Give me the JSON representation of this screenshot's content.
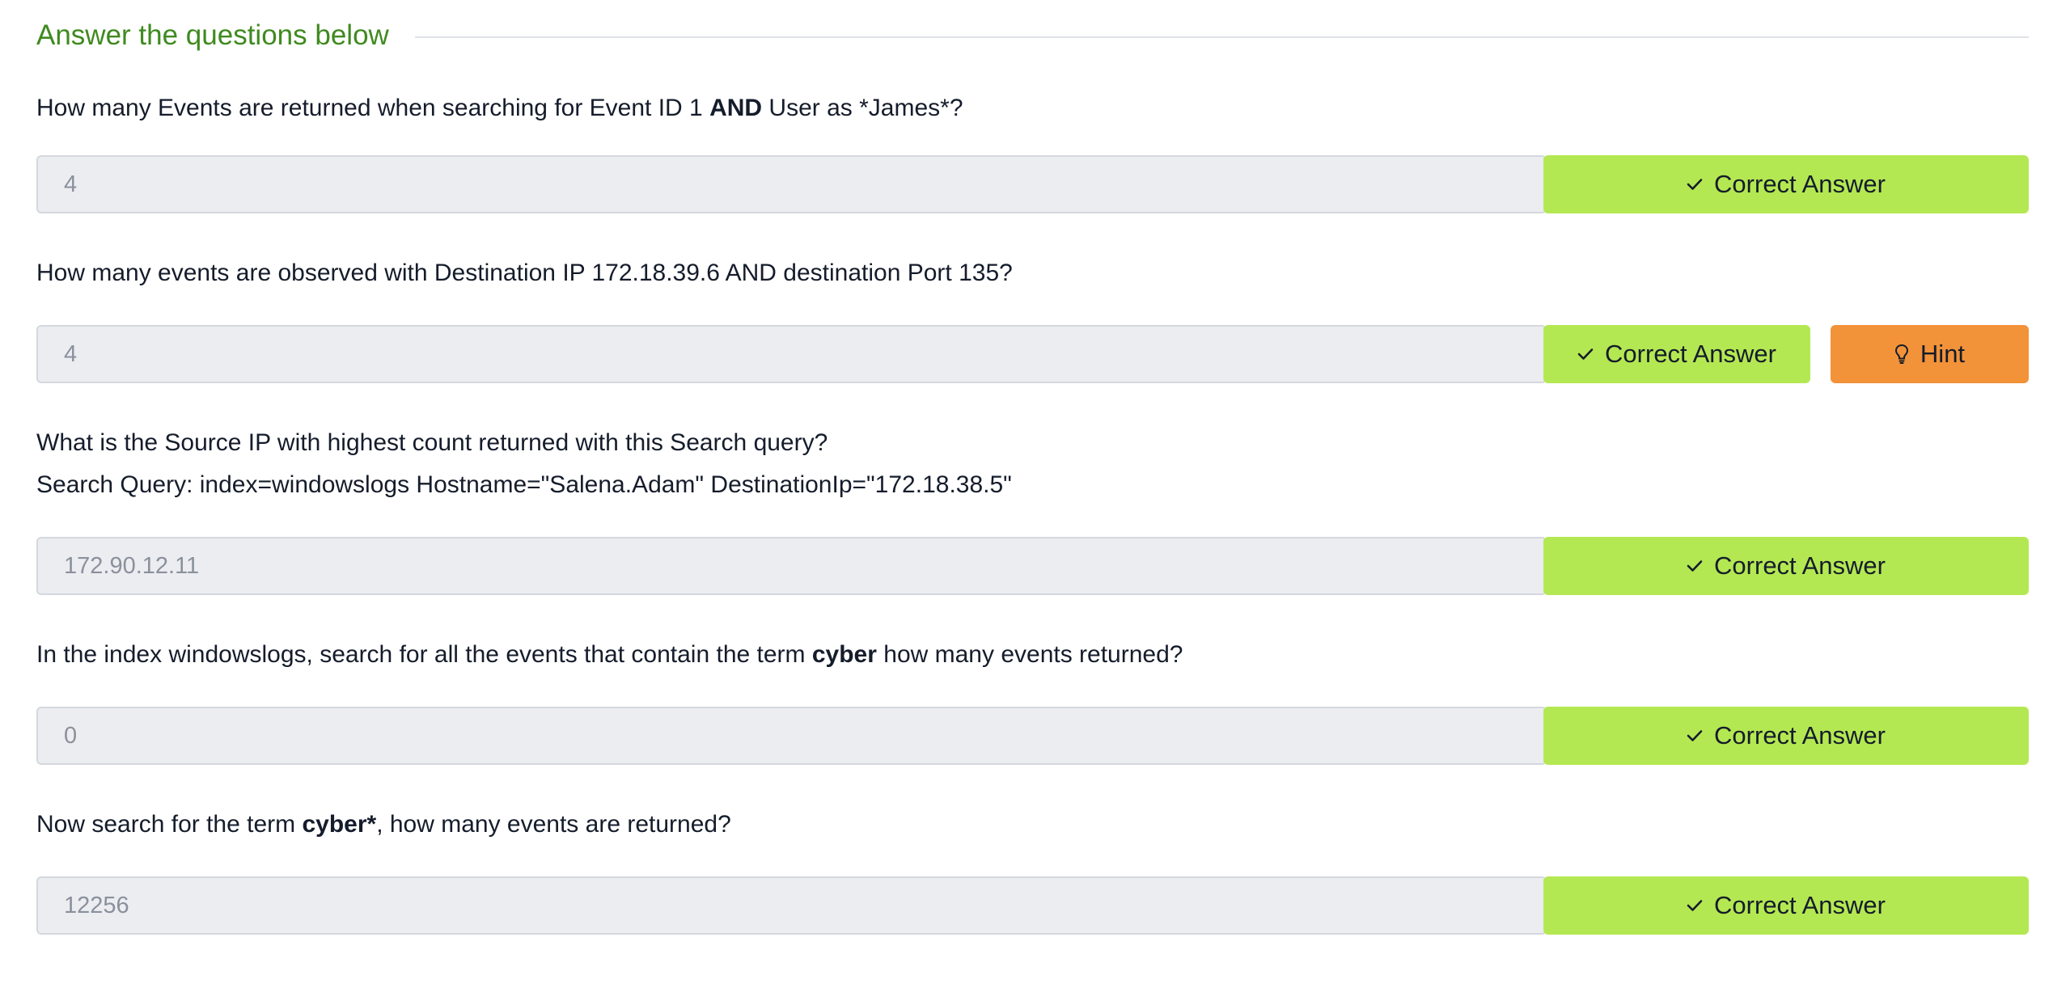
{
  "section": {
    "title": "Answer the questions below"
  },
  "questions": [
    {
      "parts": [
        "How many Events are returned when searching for Event ID 1 ",
        "AND",
        " User as *James*?"
      ],
      "answer": "4",
      "correct_label": "Correct Answer"
    },
    {
      "text": "How many events are observed with Destination IP 172.18.39.6 AND destination Port 135?",
      "answer": "4",
      "correct_label": "Correct Answer",
      "hint_label": "Hint"
    },
    {
      "line1": "What is the Source IP with highest count returned with this Search query?",
      "line2": "Search Query: index=windowslogs  Hostname=\"Salena.Adam\" DestinationIp=\"172.18.38.5\"",
      "answer": "172.90.12.11",
      "correct_label": "Correct Answer"
    },
    {
      "parts": [
        "In the index windowslogs, search for all the events that contain the term ",
        "cyber",
        " how many events returned?"
      ],
      "answer": "0",
      "correct_label": "Correct Answer"
    },
    {
      "parts": [
        "Now search for the term ",
        "cyber*",
        ", how many events are returned?"
      ],
      "answer": "12256",
      "correct_label": "Correct Answer"
    }
  ],
  "icons": {
    "correct": "check-icon",
    "hint": "lightbulb-icon"
  },
  "colors": {
    "accent_title": "#3f8a1f",
    "correct_button": "#b4e852",
    "hint_button": "#f29239",
    "answer_field_bg": "#ecedf1"
  }
}
